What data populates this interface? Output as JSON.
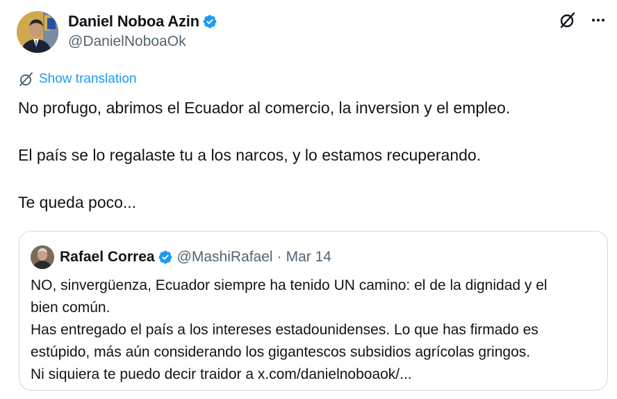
{
  "author": {
    "display_name": "Daniel Noboa Azin",
    "handle": "@DanielNoboaOk",
    "verified": true,
    "avatar_icon": "profile-photo"
  },
  "actions": {
    "grok_icon": "grok-icon",
    "more_icon": "more-options-icon"
  },
  "translation": {
    "label": "Show translation",
    "icon": "translate-icon"
  },
  "tweet": {
    "lines": [
      "No profugo, abrimos el Ecuador al comercio, la inversion y el empleo.",
      "El país se lo regalaste tu a los narcos, y lo estamos recuperando.",
      "Te queda poco..."
    ]
  },
  "quote": {
    "display_name": "Rafael Correa",
    "handle": "@MashiRafael",
    "separator": "·",
    "date": "Mar 14",
    "verified": true,
    "lines": [
      "NO, sinvergüenza, Ecuador siempre ha tenido UN camino: el de la dignidad y el",
      "bien común.",
      "Has entregado el país a los intereses estadounidenses. Lo que has firmado es",
      "estúpido, más aún considerando los gigantescos subsidios agrícolas gringos.",
      "Ni siquiera te puedo decir traidor a x.com/danielnoboaok/..."
    ]
  },
  "colors": {
    "text": "#0f1419",
    "secondary": "#536471",
    "link": "#1d9bf0",
    "border": "#cfd9de",
    "verified": "#1d9bf0"
  }
}
